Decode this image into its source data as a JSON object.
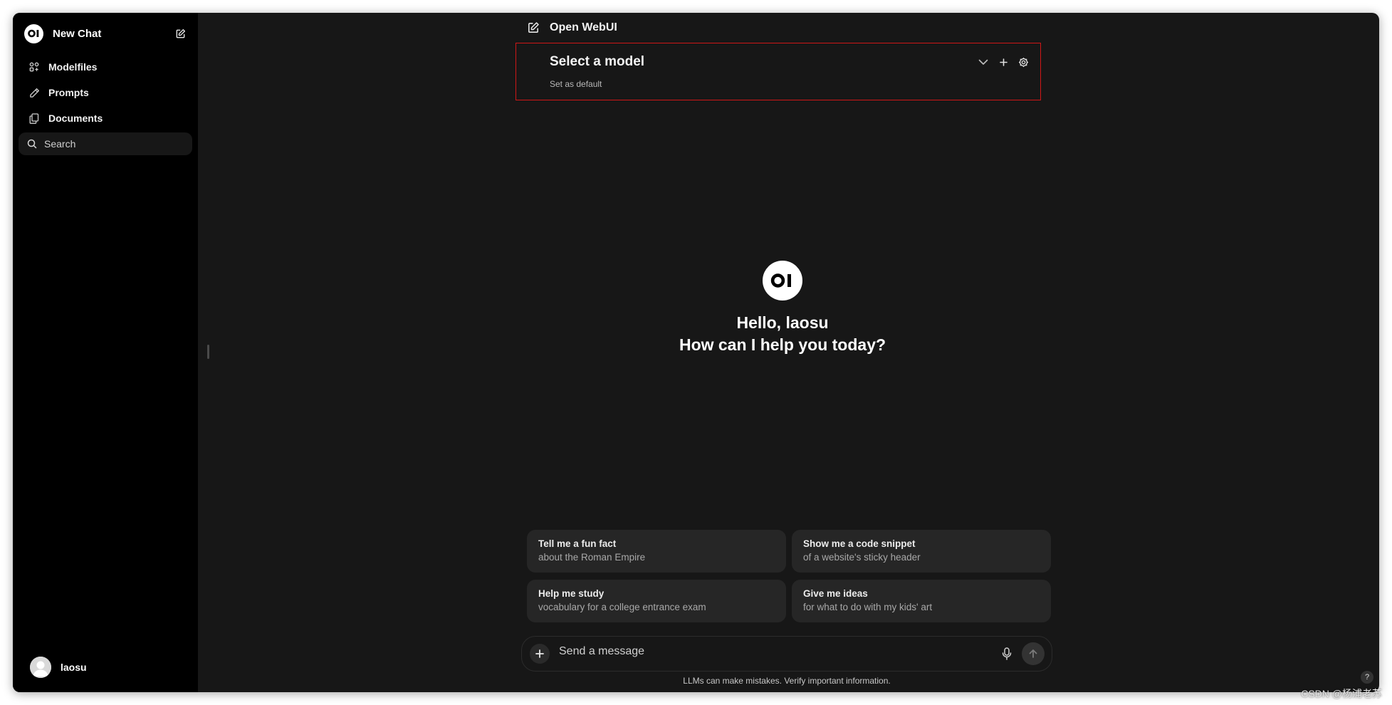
{
  "sidebar": {
    "new_chat_label": "New Chat",
    "items": [
      {
        "label": "Modelfiles",
        "icon": "modelfiles-icon"
      },
      {
        "label": "Prompts",
        "icon": "pencil-icon"
      },
      {
        "label": "Documents",
        "icon": "documents-icon"
      }
    ],
    "search_placeholder": "Search",
    "user_name": "laosu"
  },
  "header": {
    "title": "Open WebUI"
  },
  "model_selector": {
    "title": "Select a model",
    "subtitle": "Set as default"
  },
  "hero": {
    "greeting": "Hello, laosu",
    "prompt": "How can I help you today?"
  },
  "suggestions": [
    {
      "title": "Tell me a fun fact",
      "subtitle": "about the Roman Empire"
    },
    {
      "title": "Show me a code snippet",
      "subtitle": "of a website's sticky header"
    },
    {
      "title": "Help me study",
      "subtitle": "vocabulary for a college entrance exam"
    },
    {
      "title": "Give me ideas",
      "subtitle": "for what to do with my kids' art"
    }
  ],
  "composer": {
    "placeholder": "Send a message",
    "disclaimer": "LLMs can make mistakes. Verify important information."
  },
  "help_label": "?",
  "watermark": "CSDN @杨浦老苏",
  "colors": {
    "sidebar_bg": "#000000",
    "main_bg": "#171717",
    "card_bg": "#262626",
    "highlight_border": "#d01717"
  }
}
